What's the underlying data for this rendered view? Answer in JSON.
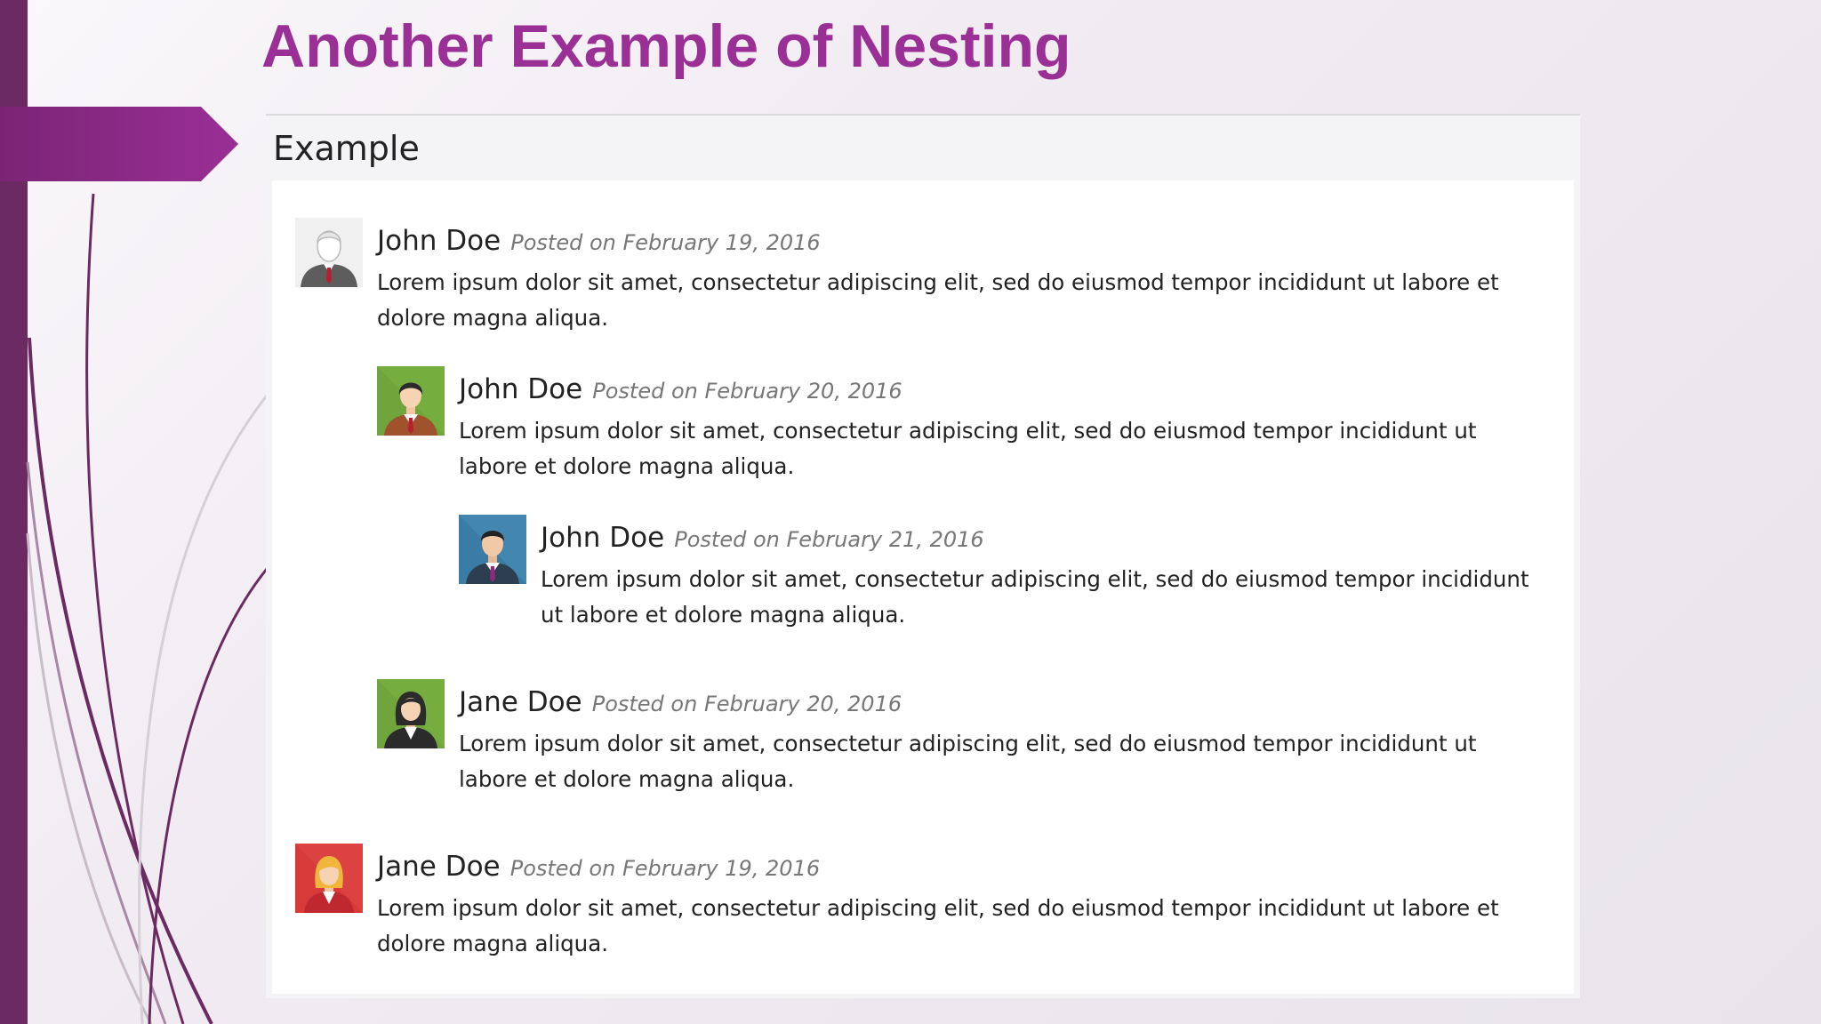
{
  "slide": {
    "title": "Another Example of Nesting"
  },
  "panel": {
    "heading": "Example"
  },
  "theme": {
    "title_color": "#9a2f96",
    "band_color": "#6b2a62",
    "arrow_color": "#9a2f96"
  },
  "comments": [
    {
      "author": "John Doe",
      "posted": "Posted on February 19, 2016",
      "text": "Lorem ipsum dolor sit amet, consectetur adipiscing elit, sed do eiusmod tempor incididunt ut labore et dolore magna aliqua.",
      "avatar": "male-avatar-grey-icon"
    },
    {
      "author": "John Doe",
      "posted": "Posted on February 20, 2016",
      "text": "Lorem ipsum dolor sit amet, consectetur adipiscing elit, sed do eiusmod tempor incididunt ut labore et dolore magna aliqua.",
      "avatar": "male-avatar-green-icon"
    },
    {
      "author": "John Doe",
      "posted": "Posted on February 21, 2016",
      "text": "Lorem ipsum dolor sit amet, consectetur adipiscing elit, sed do eiusmod tempor incididunt ut labore et dolore magna aliqua.",
      "avatar": "male-avatar-blue-icon"
    },
    {
      "author": "Jane Doe",
      "posted": "Posted on February 20, 2016",
      "text": "Lorem ipsum dolor sit amet, consectetur adipiscing elit, sed do eiusmod tempor incididunt ut labore et dolore magna aliqua.",
      "avatar": "female-avatar-green-icon"
    },
    {
      "author": "Jane Doe",
      "posted": "Posted on February 19, 2016",
      "text": "Lorem ipsum dolor sit amet, consectetur adipiscing elit, sed do eiusmod tempor incididunt ut labore et dolore magna aliqua.",
      "avatar": "female-avatar-red-icon"
    }
  ]
}
